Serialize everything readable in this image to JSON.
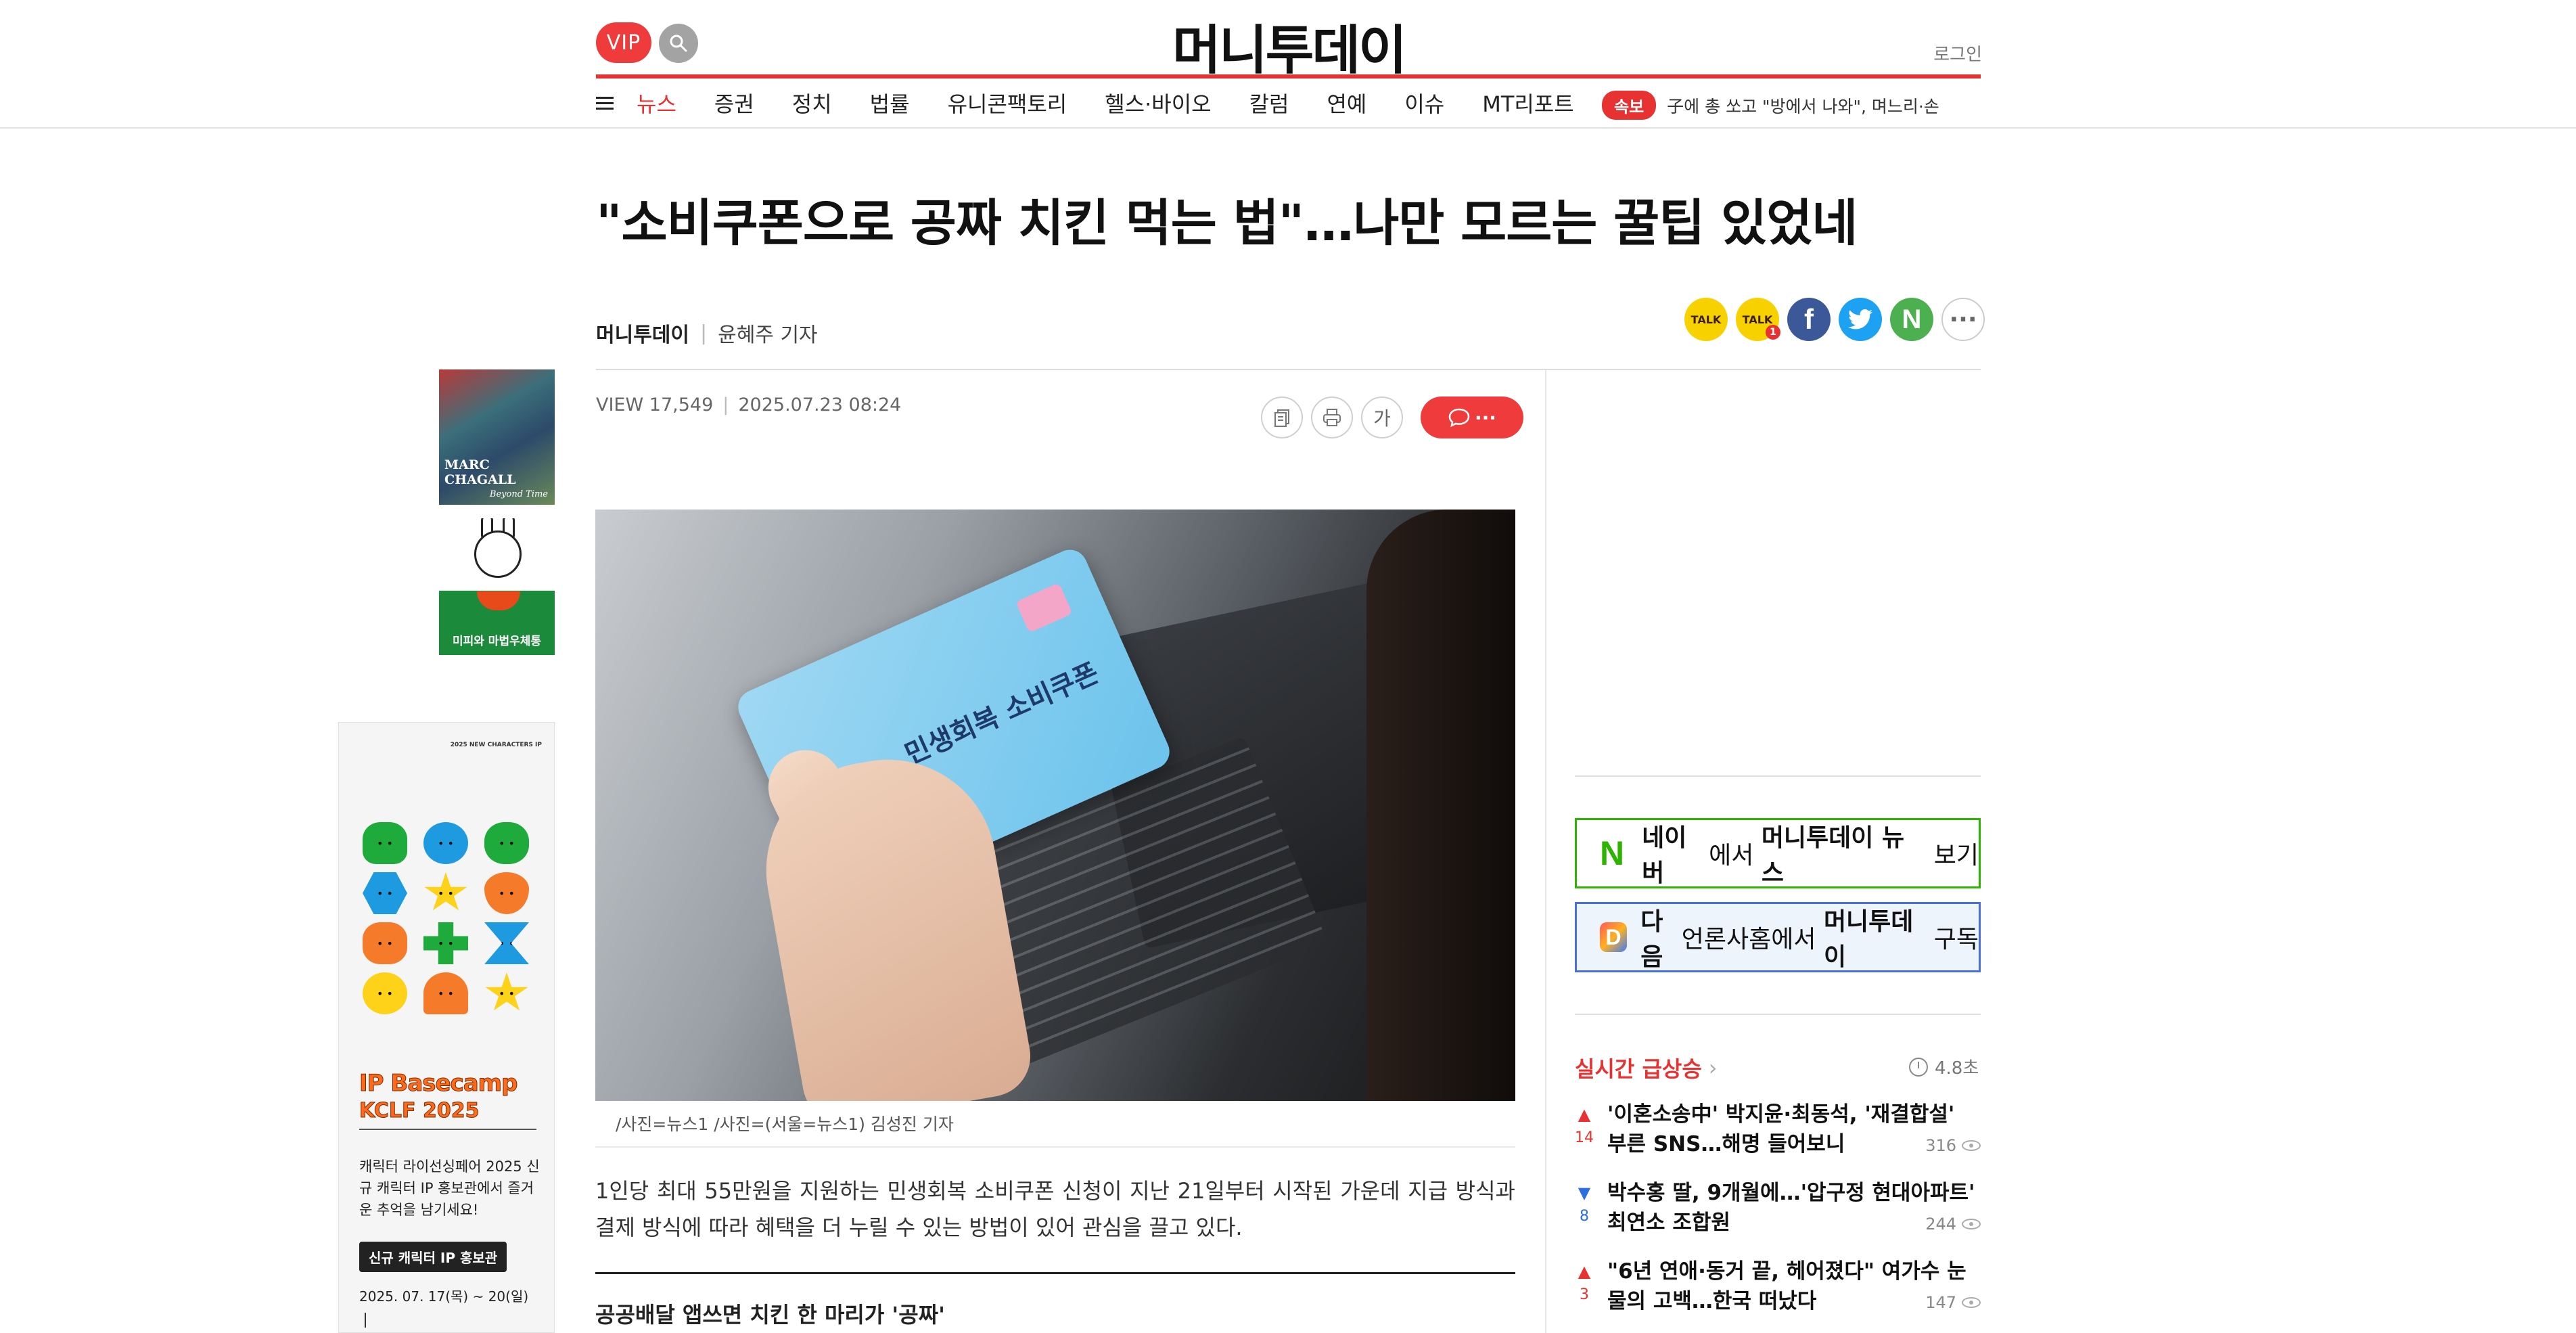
{
  "header": {
    "vip_label": "VIP",
    "logo": "머니투데이",
    "login": "로그인"
  },
  "nav": {
    "items": [
      {
        "label": "뉴스",
        "active": true
      },
      {
        "label": "증권"
      },
      {
        "label": "정치"
      },
      {
        "label": "법률"
      },
      {
        "label": "유니콘팩토리"
      },
      {
        "label": "헬스·바이오"
      },
      {
        "label": "칼럼"
      },
      {
        "label": "연예"
      },
      {
        "label": "이슈"
      },
      {
        "label": "MT리포트"
      }
    ],
    "breaking_badge": "속보",
    "breaking_text": "子에 총 쏘고 \"방에서 나와\", 며느리·손"
  },
  "article": {
    "headline": "\"소비쿠폰으로 공짜 치킨 먹는 법\"…나만 모르는 꿀팁 있었네",
    "press": "머니투데이",
    "author": "윤혜주 기자",
    "view_label": "VIEW 17,549",
    "date": "2025.07.23 08:24",
    "font_btn": "가",
    "comment_dots": "···",
    "photo_card_text": "민생회복 소비쿠폰",
    "caption": "/사진=뉴스1 /사진=(서울=뉴스1) 김성진 기자",
    "body": "1인당 최대 55만원을 지원하는 민생회복 소비쿠폰 신청이 지난 21일부터 시작된 가운데 지급 방식과 결제 방식에 따라 혜택을 더 누릴 수 있는 방법이 있어 관심을 끌고 있다.",
    "subhead": "공공배달 앱쓰면 치킨 한 마리가 '공짜'"
  },
  "share": {
    "kakao_label": "TALK",
    "kakao_badge": "1",
    "facebook": "f",
    "naver": "N",
    "more": "···"
  },
  "ads": {
    "chagall_title": "MARC CHAGALL",
    "chagall_sub": "Beyond Time",
    "miffy_title": "미피와 마법우체통",
    "kclf_header": "2025 NEW CHARACTERS IP",
    "kclf_brand1": "IP Basecamp",
    "kclf_brand2": "KCLF 2025",
    "kclf_text": "캐릭터 라이선싱페어 2025 신규 캐릭터 IP 홍보관에서 즐거운 추억을 남기세요!",
    "kclf_pill": "신규 캐릭터 IP 홍보관",
    "kclf_date": "2025. 07. 17(목) ~ 20(일)"
  },
  "sidebar": {
    "naver_prefix": "네이버",
    "naver_mid": "에서 ",
    "naver_brand": "머니투데이 뉴스",
    "naver_suffix": " 보기",
    "daum_prefix": "다음",
    "daum_mid": "언론사홈에서 ",
    "daum_brand": "머니투데이",
    "daum_suffix": " 구독",
    "realtime_title": "실시간 급상승",
    "realtime_interval": "4.8초",
    "rankings": [
      {
        "direction": "up",
        "delta": "14",
        "title": "'이혼소송中' 박지윤·최동석, '재결합설' 부른 SNS…해명 들어보니",
        "views": "316"
      },
      {
        "direction": "down",
        "delta": "8",
        "title": "박수홍 딸, 9개월에…'압구정 현대아파트' 최연소 조합원",
        "views": "244"
      },
      {
        "direction": "up",
        "delta": "3",
        "title": "\"6년 연애·동거 끝, 헤어졌다\" 여가수 눈물의 고백…한국 떠났다",
        "views": "147"
      }
    ]
  }
}
